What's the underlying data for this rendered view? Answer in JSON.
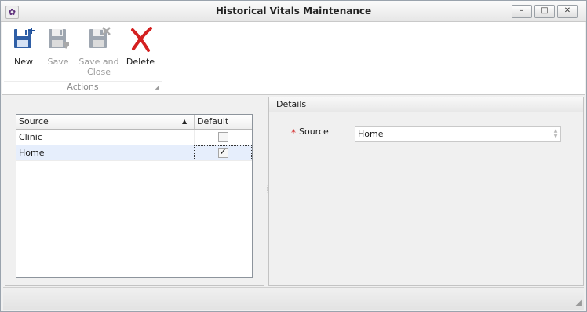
{
  "window": {
    "title": "Historical Vitals Maintenance",
    "controls": {
      "minimize": "–",
      "maximize": "□",
      "close": "✕"
    },
    "app_icon": "gear-icon"
  },
  "ribbon": {
    "group_label": "Actions",
    "buttons": [
      {
        "label": "New",
        "icon": "new-record-icon",
        "enabled": true
      },
      {
        "label": "Save",
        "icon": "save-icon",
        "enabled": false
      },
      {
        "label": "Save and Close",
        "icon": "save-close-icon",
        "enabled": false
      },
      {
        "label": "Delete",
        "icon": "delete-icon",
        "enabled": true
      }
    ]
  },
  "grid": {
    "columns": [
      "Source",
      "Default"
    ],
    "sort": {
      "column": "Source",
      "direction": "ascending",
      "glyph": "▲"
    },
    "rows": [
      {
        "source": "Clinic",
        "default": false
      },
      {
        "source": "Home",
        "default": true,
        "selected": true
      }
    ],
    "check_mark": "✓"
  },
  "details": {
    "header": "Details",
    "source_label": "Source",
    "required_mark": "*",
    "source_value": "Home"
  },
  "colors": {
    "required": "#d01818",
    "delete": "#d42020",
    "selection": "#e6eefc",
    "app_icon": "#5b2b7a"
  }
}
